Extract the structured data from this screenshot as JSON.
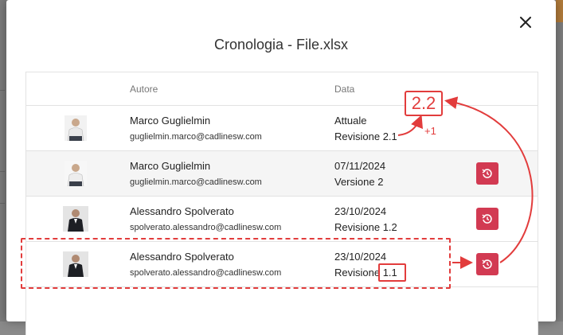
{
  "dialog": {
    "title": "Cronologia - File.xlsx",
    "close_icon": "close-icon"
  },
  "table": {
    "headers": {
      "author": "Autore",
      "date": "Data"
    },
    "rows": [
      {
        "name": "Marco Guglielmin",
        "email": "guglielmin.marco@cadlinesw.com",
        "date": "Attuale",
        "version": "Revisione 2.1",
        "has_restore": false
      },
      {
        "name": "Marco Guglielmin",
        "email": "guglielmin.marco@cadlinesw.com",
        "date": "07/11/2024",
        "version": "Versione 2",
        "has_restore": true
      },
      {
        "name": "Alessandro Spolverato",
        "email": "spolverato.alessandro@cadlinesw.com",
        "date": "23/10/2024",
        "version": "Revisione 1.2",
        "has_restore": true
      },
      {
        "name": "Alessandro Spolverato",
        "email": "spolverato.alessandro@cadlinesw.com",
        "date": "23/10/2024",
        "version": "Revisione 1.1",
        "has_restore": true
      }
    ]
  },
  "annotation": {
    "new_version": "2.2",
    "increment": "+1",
    "color": "#e23c3c"
  },
  "colors": {
    "restore_button": "#d23a52"
  }
}
